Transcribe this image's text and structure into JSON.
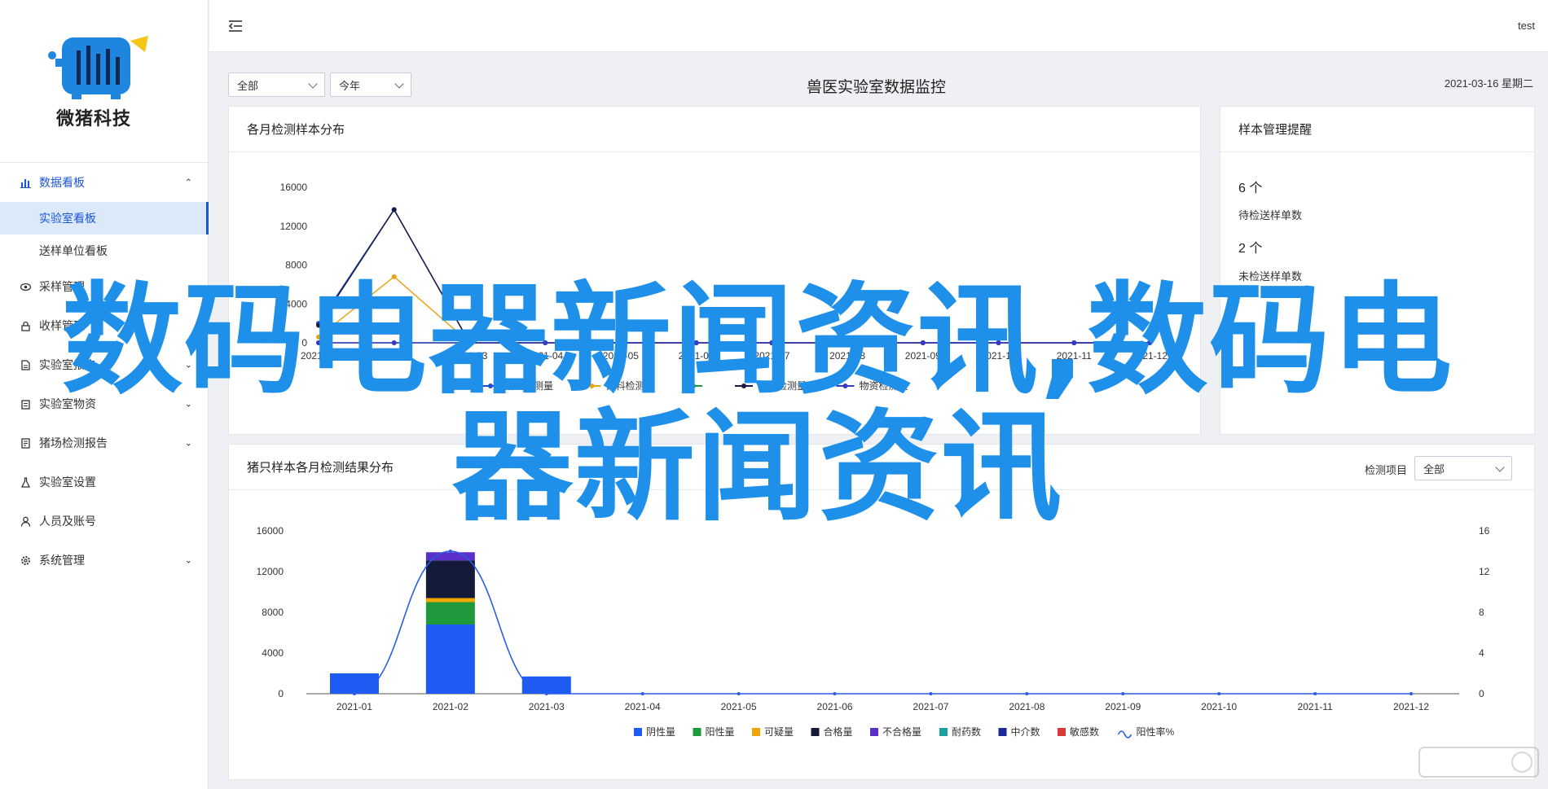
{
  "brand": {
    "name": "微猪科技"
  },
  "header": {
    "user": "test"
  },
  "sidebar": {
    "items": [
      {
        "label": "数据看板",
        "icon": "bar-chart-icon",
        "expanded": true,
        "children": [
          {
            "label": "实验室看板",
            "active": true
          },
          {
            "label": "送样单位看板"
          }
        ]
      },
      {
        "label": "采样管理",
        "icon": "eye-icon"
      },
      {
        "label": "收样管理",
        "icon": "lock-icon"
      },
      {
        "label": "实验室报告",
        "icon": "document-icon"
      },
      {
        "label": "实验室物资",
        "icon": "clipboard-icon"
      },
      {
        "label": "猪场检测报告",
        "icon": "report-icon"
      },
      {
        "label": "实验室设置",
        "icon": "flask-icon"
      },
      {
        "label": "人员及账号",
        "icon": "user-icon"
      },
      {
        "label": "系统管理",
        "icon": "gear-icon"
      }
    ]
  },
  "filters": {
    "scope": "全部",
    "period": "今年"
  },
  "dashboard": {
    "title": "兽医实验室数据监控",
    "date": "2021-03-16 星期二"
  },
  "panel_monthly": {
    "title": "各月检测样本分布"
  },
  "panel_reminder": {
    "title": "样本管理提醒",
    "stats": [
      {
        "value": "6 个",
        "label": "待检送样单数"
      },
      {
        "value": "2 个",
        "label": "未检送样单数"
      }
    ]
  },
  "panel_results": {
    "title": "猪只样本各月检测结果分布",
    "filter_label": "检测项目",
    "filter_value": "全部"
  },
  "watermark": {
    "text": "数码电器新闻资讯,数码电器新闻资讯"
  },
  "colors": {
    "accent": "#1a56db",
    "watermark": "#1e90ea"
  },
  "chart_data": [
    {
      "type": "line",
      "categories": [
        "2021-01",
        "2021-02",
        "2021-03",
        "2021-04",
        "2021-05",
        "2021-06",
        "2021-07",
        "2021-08",
        "2021-09",
        "2021-10",
        "2021-11",
        "2021-12"
      ],
      "ylim": [
        0,
        16000
      ],
      "yticks": [
        0,
        4000,
        8000,
        12000,
        16000
      ],
      "legend_position": "bottom",
      "grid": false,
      "series": [
        {
          "name": "猪场检测量",
          "color": "#1a4fd0",
          "values": [
            2000,
            13700,
            0,
            0,
            0,
            0,
            0,
            0,
            0,
            0,
            0,
            0
          ]
        },
        {
          "name": "饲料检测量",
          "color": "#e8a317",
          "values": [
            600,
            6800,
            0,
            0,
            0,
            0,
            0,
            0,
            0,
            0,
            0,
            0
          ]
        },
        {
          "name": "",
          "color": "#1f9a3a",
          "values": [
            0,
            0,
            0,
            0,
            0,
            0,
            0,
            0,
            0,
            0,
            0,
            0
          ]
        },
        {
          "name": "人员检测量",
          "color": "#1a1a4a",
          "values": [
            1800,
            13700,
            0,
            0,
            0,
            0,
            0,
            0,
            0,
            0,
            0,
            0
          ]
        },
        {
          "name": "物资检测量",
          "color": "#3a3ac8",
          "values": [
            0,
            0,
            0,
            0,
            0,
            0,
            0,
            0,
            0,
            0,
            0,
            0
          ]
        }
      ]
    },
    {
      "type": "bar",
      "stacked": true,
      "categories": [
        "2021-01",
        "2021-02",
        "2021-03",
        "2021-04",
        "2021-05",
        "2021-06",
        "2021-07",
        "2021-08",
        "2021-09",
        "2021-10",
        "2021-11",
        "2021-12"
      ],
      "ylim": [
        0,
        16000
      ],
      "yticks": [
        0,
        4000,
        8000,
        12000,
        16000
      ],
      "y2lim": [
        0,
        16
      ],
      "y2ticks": [
        0,
        4,
        8,
        12,
        16
      ],
      "legend_position": "bottom",
      "grid": false,
      "series": [
        {
          "name": "阴性量",
          "color": "#1e5bf5",
          "values": [
            2000,
            6800,
            1700,
            0,
            0,
            0,
            0,
            0,
            0,
            0,
            0,
            0
          ]
        },
        {
          "name": "阳性量",
          "color": "#1e9a3c",
          "values": [
            0,
            2200,
            0,
            0,
            0,
            0,
            0,
            0,
            0,
            0,
            0,
            0
          ]
        },
        {
          "name": "可疑量",
          "color": "#f0a500",
          "values": [
            0,
            400,
            0,
            0,
            0,
            0,
            0,
            0,
            0,
            0,
            0,
            0
          ]
        },
        {
          "name": "合格量",
          "color": "#141a3a",
          "values": [
            0,
            3700,
            0,
            0,
            0,
            0,
            0,
            0,
            0,
            0,
            0,
            0
          ]
        },
        {
          "name": "不合格量",
          "color": "#5b2fc9",
          "values": [
            0,
            800,
            0,
            0,
            0,
            0,
            0,
            0,
            0,
            0,
            0,
            0
          ]
        },
        {
          "name": "耐药数",
          "color": "#1aa0a0",
          "values": [
            0,
            0,
            0,
            0,
            0,
            0,
            0,
            0,
            0,
            0,
            0,
            0
          ]
        },
        {
          "name": "中介数",
          "color": "#1a2a9a",
          "values": [
            0,
            0,
            0,
            0,
            0,
            0,
            0,
            0,
            0,
            0,
            0,
            0
          ]
        },
        {
          "name": "敏感数",
          "color": "#d83a3a",
          "values": [
            0,
            0,
            0,
            0,
            0,
            0,
            0,
            0,
            0,
            0,
            0,
            0
          ]
        }
      ],
      "line_series": {
        "name": "阳性率%",
        "color": "#2a5ce8",
        "axis": "right",
        "values": [
          0,
          14,
          0,
          0,
          0,
          0,
          0,
          0,
          0,
          0,
          0,
          0
        ]
      }
    }
  ]
}
